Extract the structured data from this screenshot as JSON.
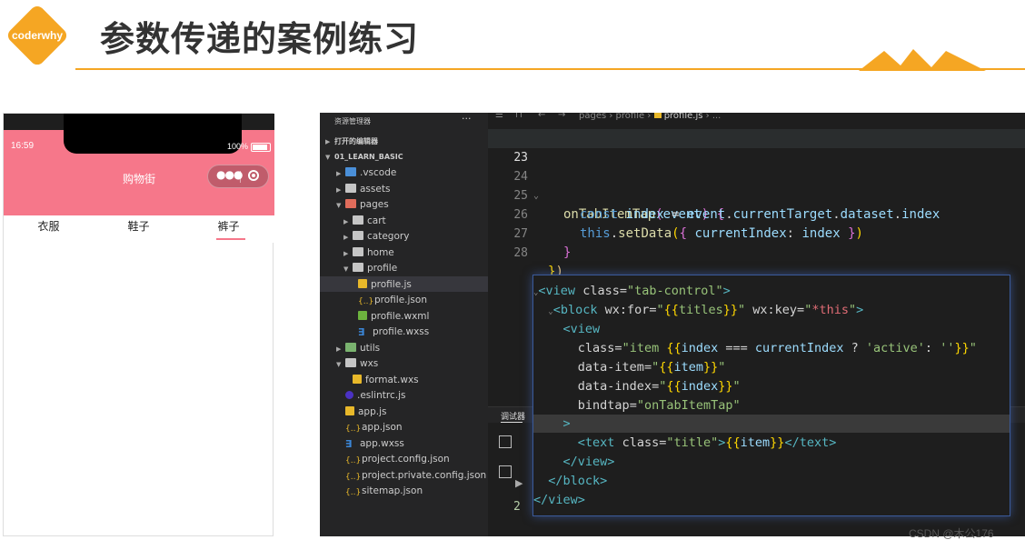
{
  "header": {
    "logo_text": "coderwhy",
    "title": "参数传递的案例练习",
    "accent_color": "#f5a623"
  },
  "phone": {
    "status_time": "16:59",
    "battery_text": "100%",
    "nav_title": "购物街",
    "theme_color": "#f6778a",
    "tabs": [
      "衣服",
      "鞋子",
      "裤子"
    ],
    "active_tab_index": 2
  },
  "explorer": {
    "title": "资源管理器",
    "more": "···",
    "open_editors": "打开的编辑器",
    "root": "01_LEARN_BASIC",
    "items": [
      {
        "label": ".vscode",
        "icon": "folder-vscode-icon",
        "depth": 1,
        "kind": "folder"
      },
      {
        "label": "assets",
        "icon": "folder-assets-icon",
        "depth": 1,
        "kind": "folder"
      },
      {
        "label": "pages",
        "icon": "folder-pages-icon",
        "depth": 1,
        "kind": "folder-open"
      },
      {
        "label": "cart",
        "icon": "folder-icon",
        "depth": 2,
        "kind": "folder"
      },
      {
        "label": "category",
        "icon": "folder-icon",
        "depth": 2,
        "kind": "folder"
      },
      {
        "label": "home",
        "icon": "folder-icon",
        "depth": 2,
        "kind": "folder"
      },
      {
        "label": "profile",
        "icon": "folder-open-icon",
        "depth": 2,
        "kind": "folder-open"
      },
      {
        "label": "profile.js",
        "icon": "js-file-icon",
        "depth": 3,
        "kind": "js"
      },
      {
        "label": "profile.json",
        "icon": "json-file-icon",
        "depth": 3,
        "kind": "json"
      },
      {
        "label": "profile.wxml",
        "icon": "wxml-file-icon",
        "depth": 3,
        "kind": "wxml"
      },
      {
        "label": "profile.wxss",
        "icon": "css-file-icon",
        "depth": 3,
        "kind": "css"
      },
      {
        "label": "utils",
        "icon": "folder-utils-icon",
        "depth": 1,
        "kind": "folder"
      },
      {
        "label": "wxs",
        "icon": "folder-open-icon",
        "depth": 1,
        "kind": "folder-open"
      },
      {
        "label": "format.wxs",
        "icon": "js-file-icon",
        "depth": 2,
        "kind": "js"
      },
      {
        "label": ".eslintrc.js",
        "icon": "eslint-file-icon",
        "depth": 1,
        "kind": "eslint"
      },
      {
        "label": "app.js",
        "icon": "js-file-icon",
        "depth": 1,
        "kind": "js"
      },
      {
        "label": "app.json",
        "icon": "json-file-icon",
        "depth": 1,
        "kind": "json"
      },
      {
        "label": "app.wxss",
        "icon": "css-file-icon",
        "depth": 1,
        "kind": "css"
      },
      {
        "label": "project.config.json",
        "icon": "json-file-icon",
        "depth": 1,
        "kind": "json"
      },
      {
        "label": "project.private.config.json",
        "icon": "json-file-icon",
        "depth": 1,
        "kind": "json"
      },
      {
        "label": "sitemap.json",
        "icon": "json-file-icon",
        "depth": 1,
        "kind": "json"
      }
    ]
  },
  "editor": {
    "breadcrumb": [
      "pages",
      "profile",
      "profile.js",
      "..."
    ],
    "lines": [
      {
        "num": "23",
        "text": ""
      },
      {
        "num": "24",
        "text": "onTabItemTap(event) {"
      },
      {
        "num": "25",
        "text": "const index = event.currentTarget.dataset.index"
      },
      {
        "num": "26",
        "text": "this.setData({ currentIndex: index })"
      },
      {
        "num": "27",
        "text": "}"
      },
      {
        "num": "28",
        "text": "})"
      }
    ],
    "debug_tab": "调试器",
    "console_lines": [
      "2"
    ]
  },
  "popup": {
    "lines": [
      "<view class=\"tab-control\">",
      "<block wx:for=\"{{titles}}\" wx:key=\"*this\">",
      "<view",
      "class=\"item {{index === currentIndex ? 'active': ''}}\"",
      "data-item=\"{{item}}\"",
      "data-index=\"{{index}}\"",
      "bindtap=\"onTabItemTap\"",
      ">",
      "<text class=\"title\">{{item}}</text>",
      "</view>",
      "</block>",
      "</view>"
    ]
  },
  "watermark": "CSDN @木公176"
}
